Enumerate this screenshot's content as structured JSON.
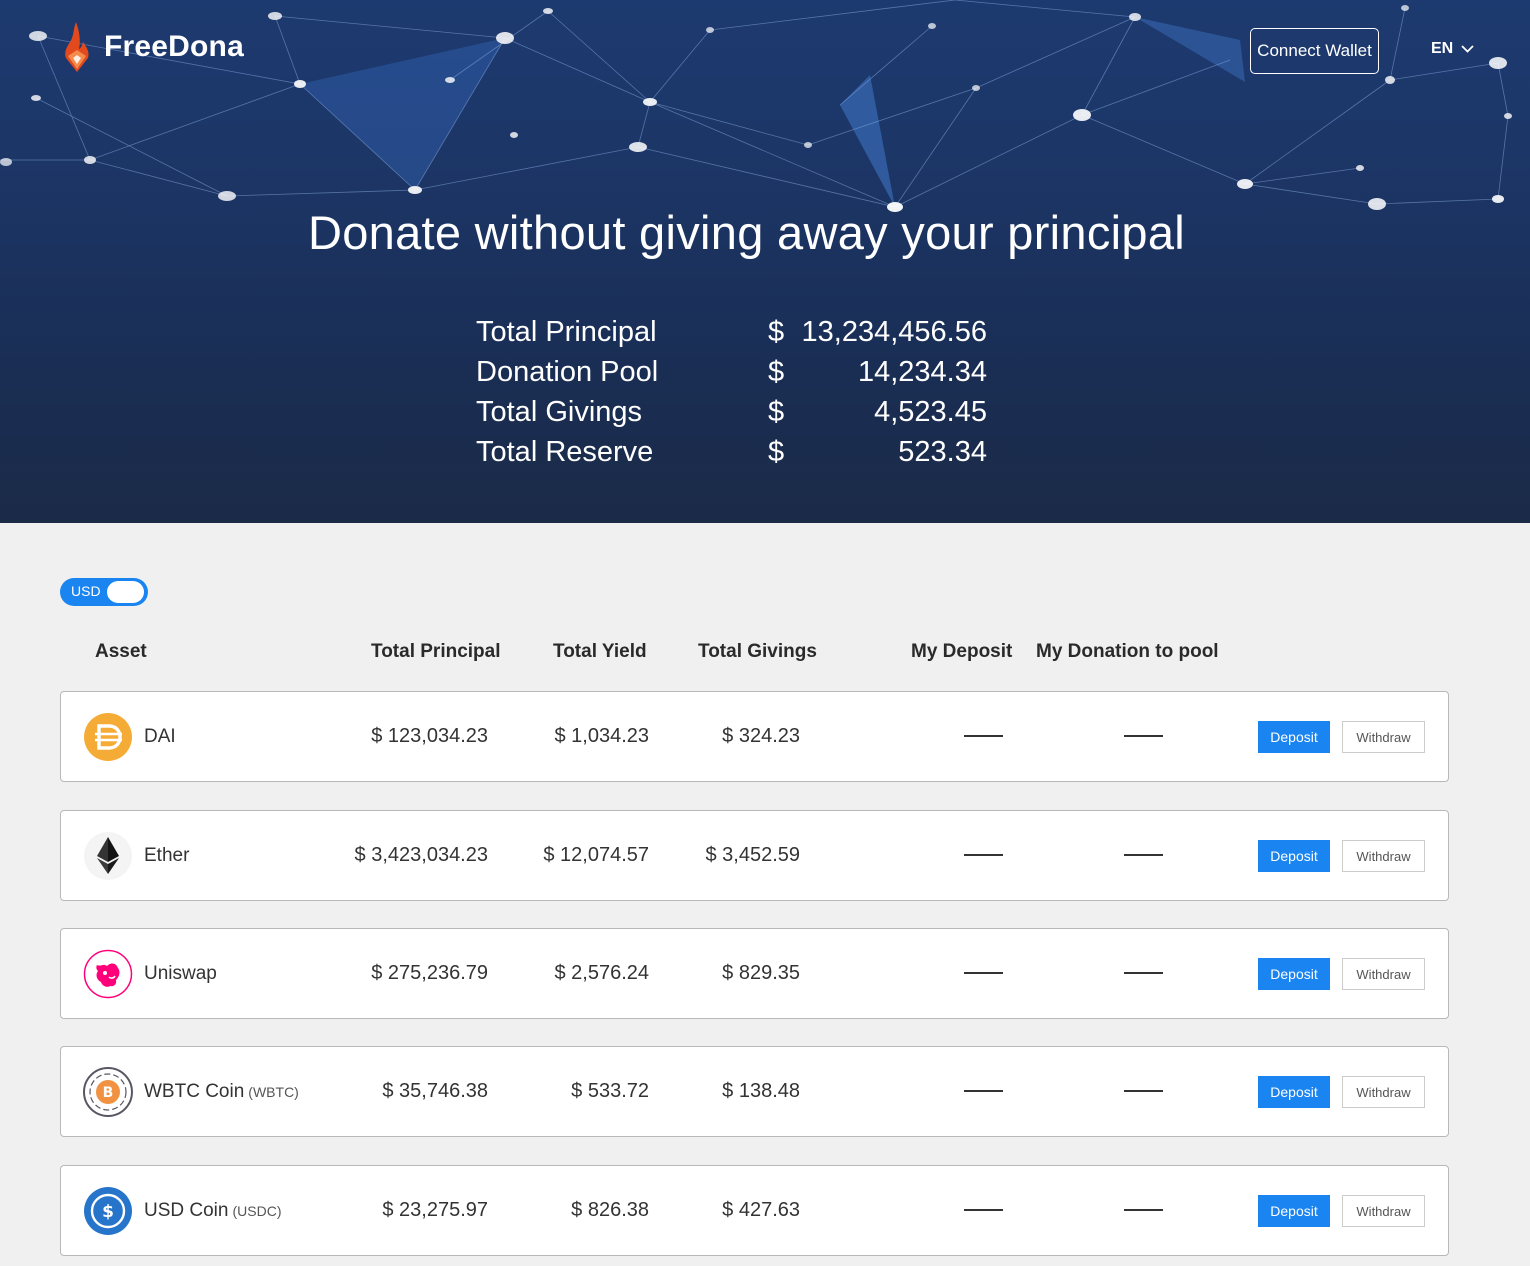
{
  "app": {
    "name": "FreeDona"
  },
  "header": {
    "connect_label": "Connect Wallet",
    "language": "EN"
  },
  "hero": {
    "title": "Donate without giving away your principal",
    "stats": [
      {
        "label": "Total Principal",
        "currency": "$",
        "value": "13,234,456.56"
      },
      {
        "label": "Donation Pool",
        "currency": "$",
        "value": "14,234.34"
      },
      {
        "label": "Total Givings",
        "currency": "$",
        "value": "4,523.45"
      },
      {
        "label": "Total Reserve",
        "currency": "$",
        "value": "523.34"
      }
    ]
  },
  "toggle": {
    "label": "USD"
  },
  "table": {
    "headers": [
      "Asset",
      "Total Principal",
      "Total Yield",
      "Total Givings",
      "My Deposit",
      "My Donation to pool"
    ],
    "deposit_label": "Deposit",
    "withdraw_label": "Withdraw",
    "rows": [
      {
        "name": "DAI",
        "symbol": "",
        "icon": "dai-icon",
        "principal": "$ 123,034.23",
        "yield": "$ 1,034.23",
        "givings": "$ 324.23",
        "my_deposit": "——",
        "my_donation": "——"
      },
      {
        "name": "Ether",
        "symbol": "",
        "icon": "ether-icon",
        "principal": "$ 3,423,034.23",
        "yield": "$ 12,074.57",
        "givings": "$ 3,452.59",
        "my_deposit": "——",
        "my_donation": "——"
      },
      {
        "name": "Uniswap",
        "symbol": "",
        "icon": "uniswap-icon",
        "principal": "$ 275,236.79",
        "yield": "$ 2,576.24",
        "givings": "$ 829.35",
        "my_deposit": "——",
        "my_donation": "——"
      },
      {
        "name": "WBTC Coin",
        "symbol": "(WBTC)",
        "icon": "wbtc-icon",
        "principal": "$ 35,746.38",
        "yield": "$ 533.72",
        "givings": "$ 138.48",
        "my_deposit": "——",
        "my_donation": "——"
      },
      {
        "name": "USD Coin",
        "symbol": "(USDC)",
        "icon": "usdc-icon",
        "principal": "$ 23,275.97",
        "yield": "$ 826.38",
        "givings": "$ 427.63",
        "my_deposit": "——",
        "my_donation": "——"
      }
    ]
  },
  "colors": {
    "accent": "#1a84f0",
    "hero_bg": "#1c3565",
    "dai": "#f5ac37",
    "uniswap": "#ff007a",
    "usdc": "#2775ca"
  }
}
